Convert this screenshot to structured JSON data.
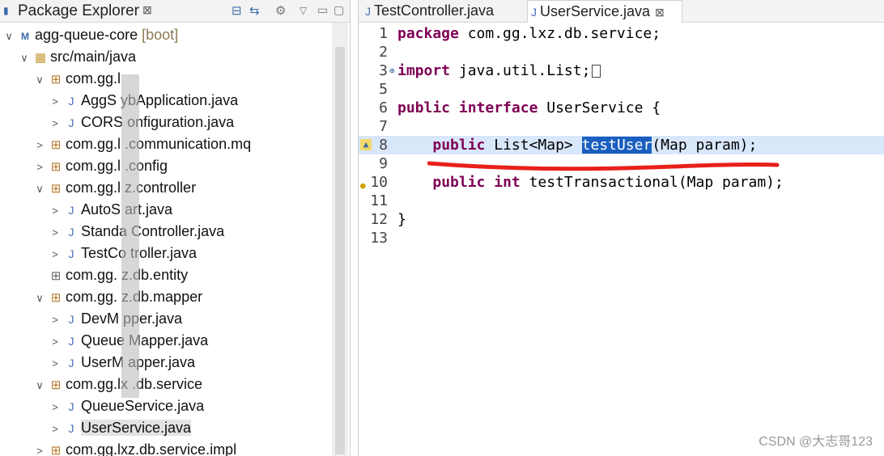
{
  "left_panel": {
    "title": "Package Explorer",
    "close": "⊠",
    "icons": [
      "collapse-all-icon",
      "link-editor-icon",
      "filter-icon",
      "view-menu-icon"
    ],
    "tree": [
      {
        "indent": 0,
        "arrow": "∨",
        "icon": "project-icon",
        "label": "agg-queue-core",
        "suffix": " [boot]"
      },
      {
        "indent": 1,
        "arrow": "∨",
        "icon": "source-folder-icon",
        "label": "src/main/java"
      },
      {
        "indent": 2,
        "arrow": "∨",
        "icon": "package-icon",
        "label": "com.gg.l"
      },
      {
        "indent": 3,
        "arrow": ">",
        "icon": "java-file-icon",
        "label": "AggS   ybApplication.java"
      },
      {
        "indent": 3,
        "arrow": ">",
        "icon": "java-file-icon",
        "label": "CORS   onfiguration.java"
      },
      {
        "indent": 2,
        "arrow": ">",
        "icon": "package-icon",
        "label": "com.gg.l  .communication.mq"
      },
      {
        "indent": 2,
        "arrow": ">",
        "icon": "package-icon",
        "label": "com.gg.l  .config"
      },
      {
        "indent": 2,
        "arrow": "∨",
        "icon": "package-icon",
        "label": "com.gg.l  z.controller"
      },
      {
        "indent": 3,
        "arrow": ">",
        "icon": "java-file-icon",
        "label": "AutoS   art.java"
      },
      {
        "indent": 3,
        "arrow": ">",
        "icon": "java-file-icon",
        "label": "Standa   Controller.java"
      },
      {
        "indent": 3,
        "arrow": ">",
        "icon": "java-file-icon",
        "label": "TestCo   troller.java"
      },
      {
        "indent": 2,
        "arrow": "",
        "icon": "empty-package-icon",
        "label": "com.gg.   z.db.entity"
      },
      {
        "indent": 2,
        "arrow": "∨",
        "icon": "package-icon",
        "label": "com.gg.   z.db.mapper"
      },
      {
        "indent": 3,
        "arrow": ">",
        "icon": "java-file-icon",
        "label": "DevM   pper.java"
      },
      {
        "indent": 3,
        "arrow": ">",
        "icon": "java-file-icon",
        "label": "Queue  Mapper.java"
      },
      {
        "indent": 3,
        "arrow": ">",
        "icon": "java-file-icon",
        "label": "UserM   apper.java"
      },
      {
        "indent": 2,
        "arrow": "∨",
        "icon": "package-icon",
        "label": "com.gg.lx  .db.service"
      },
      {
        "indent": 3,
        "arrow": ">",
        "icon": "java-file-icon",
        "label": "QueueService.java"
      },
      {
        "indent": 3,
        "arrow": ">",
        "icon": "java-file-icon",
        "label": "UserService.java",
        "selected": true
      },
      {
        "indent": 2,
        "arrow": ">",
        "icon": "package-icon",
        "label": "com.gg.lxz.db.service.impl"
      }
    ]
  },
  "editor": {
    "tabs": [
      {
        "label": "TestController.java",
        "active": false
      },
      {
        "label": "UserService.java",
        "active": true,
        "close": "⊠"
      }
    ],
    "lines": [
      {
        "n": "1",
        "parts": [
          {
            "t": "package",
            "kw": true
          },
          {
            "t": " com.gg.lxz.db.service;"
          }
        ]
      },
      {
        "n": "2",
        "parts": []
      },
      {
        "n": "3",
        "fold": "⊕",
        "parts": [
          {
            "t": "import",
            "kw": true
          },
          {
            "t": " java.util.List;"
          }
        ],
        "box": true
      },
      {
        "n": "5",
        "parts": []
      },
      {
        "n": "6",
        "parts": [
          {
            "t": "public",
            "kw": true
          },
          {
            "t": " "
          },
          {
            "t": "interface",
            "kw": true
          },
          {
            "t": " UserService {"
          }
        ]
      },
      {
        "n": "7",
        "parts": []
      },
      {
        "n": "8",
        "marker": "m8",
        "highlight": true,
        "parts": [
          {
            "t": "    "
          },
          {
            "t": "public",
            "kw": true
          },
          {
            "t": " List<Map> "
          },
          {
            "t": "testUser",
            "sel": true
          },
          {
            "t": "(Map param);"
          }
        ]
      },
      {
        "n": "9",
        "parts": []
      },
      {
        "n": "10",
        "marker": "m10",
        "parts": [
          {
            "t": "    "
          },
          {
            "t": "public",
            "kw": true
          },
          {
            "t": " "
          },
          {
            "t": "int",
            "kw": true
          },
          {
            "t": " testTransactional(Map param);"
          }
        ]
      },
      {
        "n": "11",
        "parts": []
      },
      {
        "n": "12",
        "parts": [
          {
            "t": "}"
          }
        ]
      },
      {
        "n": "13",
        "parts": []
      }
    ]
  },
  "watermark": "CSDN @大志哥123"
}
